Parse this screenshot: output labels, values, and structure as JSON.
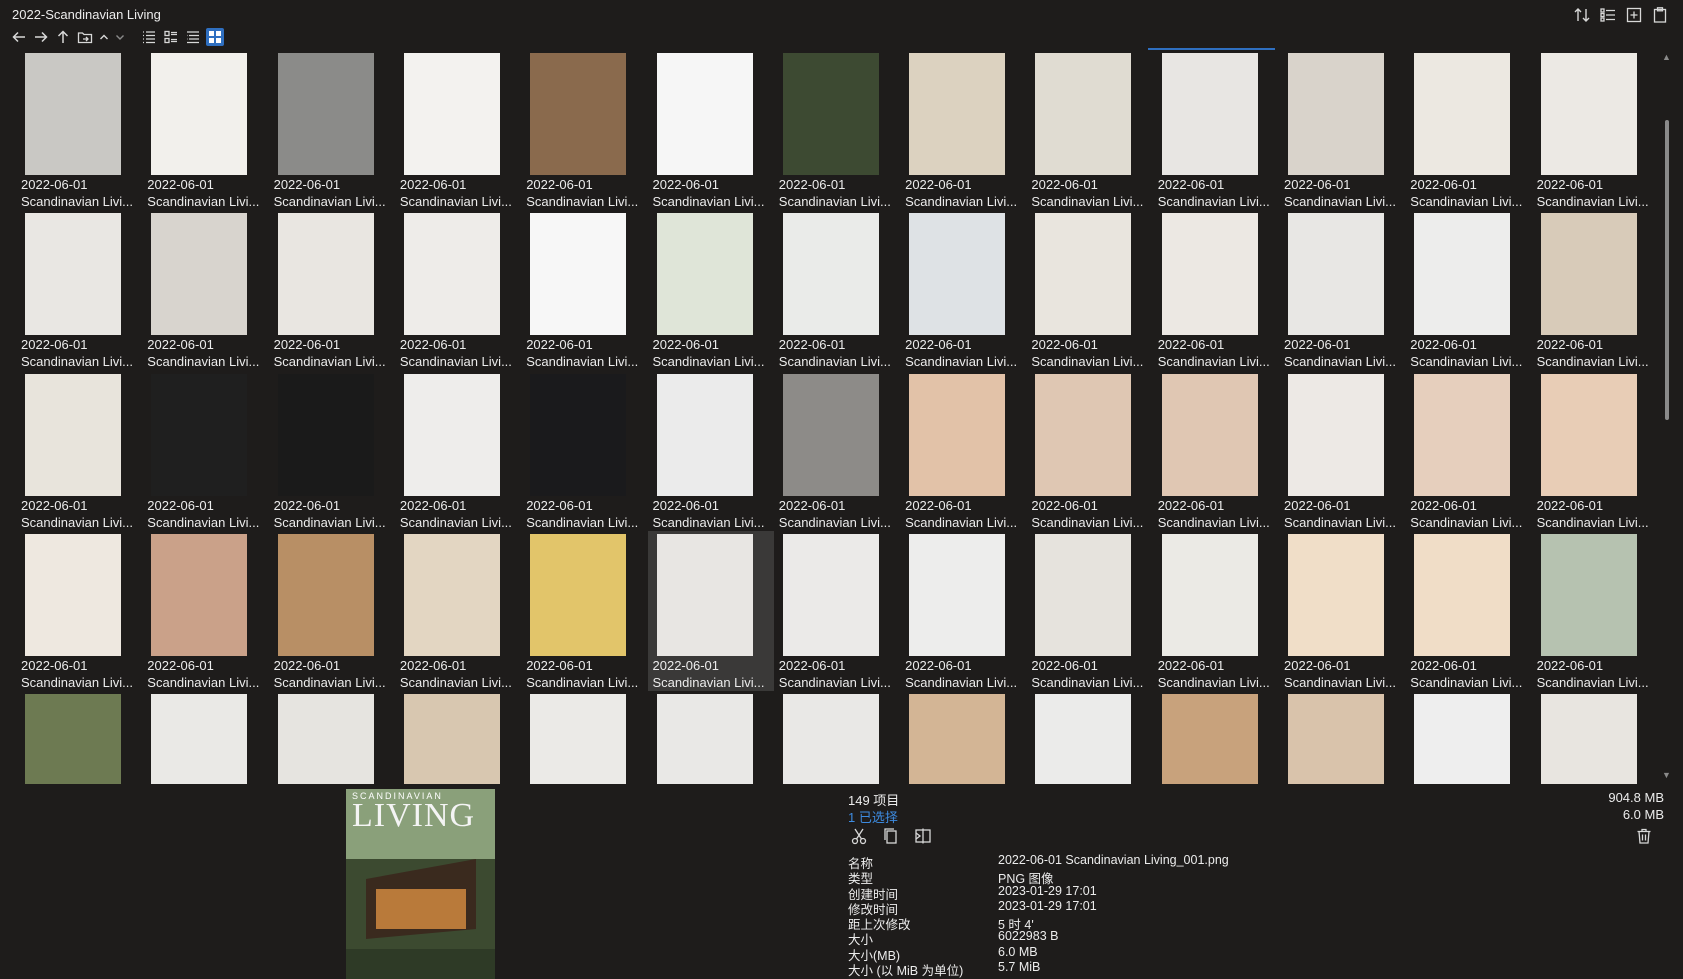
{
  "window": {
    "title": "2022-Scandinavian Living"
  },
  "toolbar": {
    "buttons": [
      "back-icon",
      "forward-icon",
      "up-icon",
      "folder-icon",
      "sort-up-icon",
      "sort-down-icon",
      "list-view-icon",
      "details-view-icon",
      "tree-view-icon",
      "thumbnail-view-icon"
    ],
    "top_right": [
      "sort-icon",
      "panel-icon",
      "new-window-icon",
      "clipboard-icon"
    ]
  },
  "files": [
    {
      "date": "2022-06-01",
      "name": "Scandinavian Livi..."
    },
    {
      "date": "2022-06-01",
      "name": "Scandinavian Livi..."
    },
    {
      "date": "2022-06-01",
      "name": "Scandinavian Livi..."
    },
    {
      "date": "2022-06-01",
      "name": "Scandinavian Livi..."
    },
    {
      "date": "2022-06-01",
      "name": "Scandinavian Livi..."
    },
    {
      "date": "2022-06-01",
      "name": "Scandinavian Livi..."
    },
    {
      "date": "2022-06-01",
      "name": "Scandinavian Livi..."
    },
    {
      "date": "2022-06-01",
      "name": "Scandinavian Livi..."
    },
    {
      "date": "2022-06-01",
      "name": "Scandinavian Livi..."
    },
    {
      "date": "2022-06-01",
      "name": "Scandinavian Livi..."
    },
    {
      "date": "2022-06-01",
      "name": "Scandinavian Livi..."
    },
    {
      "date": "2022-06-01",
      "name": "Scandinavian Livi..."
    },
    {
      "date": "2022-06-01",
      "name": "Scandinavian Livi..."
    },
    {
      "date": "2022-06-01",
      "name": "Scandinavian Livi..."
    },
    {
      "date": "2022-06-01",
      "name": "Scandinavian Livi..."
    },
    {
      "date": "2022-06-01",
      "name": "Scandinavian Livi..."
    },
    {
      "date": "2022-06-01",
      "name": "Scandinavian Livi..."
    },
    {
      "date": "2022-06-01",
      "name": "Scandinavian Livi..."
    },
    {
      "date": "2022-06-01",
      "name": "Scandinavian Livi..."
    },
    {
      "date": "2022-06-01",
      "name": "Scandinavian Livi..."
    },
    {
      "date": "2022-06-01",
      "name": "Scandinavian Livi..."
    },
    {
      "date": "2022-06-01",
      "name": "Scandinavian Livi..."
    },
    {
      "date": "2022-06-01",
      "name": "Scandinavian Livi..."
    },
    {
      "date": "2022-06-01",
      "name": "Scandinavian Livi..."
    },
    {
      "date": "2022-06-01",
      "name": "Scandinavian Livi..."
    },
    {
      "date": "2022-06-01",
      "name": "Scandinavian Livi..."
    },
    {
      "date": "2022-06-01",
      "name": "Scandinavian Livi..."
    },
    {
      "date": "2022-06-01",
      "name": "Scandinavian Livi..."
    },
    {
      "date": "2022-06-01",
      "name": "Scandinavian Livi..."
    },
    {
      "date": "2022-06-01",
      "name": "Scandinavian Livi..."
    },
    {
      "date": "2022-06-01",
      "name": "Scandinavian Livi..."
    },
    {
      "date": "2022-06-01",
      "name": "Scandinavian Livi..."
    },
    {
      "date": "2022-06-01",
      "name": "Scandinavian Livi..."
    },
    {
      "date": "2022-06-01",
      "name": "Scandinavian Livi..."
    },
    {
      "date": "2022-06-01",
      "name": "Scandinavian Livi..."
    },
    {
      "date": "2022-06-01",
      "name": "Scandinavian Livi..."
    },
    {
      "date": "2022-06-01",
      "name": "Scandinavian Livi..."
    },
    {
      "date": "2022-06-01",
      "name": "Scandinavian Livi..."
    },
    {
      "date": "2022-06-01",
      "name": "Scandinavian Livi..."
    },
    {
      "date": "2022-06-01",
      "name": "Scandinavian Livi..."
    },
    {
      "date": "2022-06-01",
      "name": "Scandinavian Livi..."
    },
    {
      "date": "2022-06-01",
      "name": "Scandinavian Livi..."
    },
    {
      "date": "2022-06-01",
      "name": "Scandinavian Livi..."
    },
    {
      "date": "2022-06-01",
      "name": "Scandinavian Livi..."
    },
    {
      "date": "2022-06-01",
      "name": "Scandinavian Livi..."
    },
    {
      "date": "2022-06-01",
      "name": "Scandinavian Livi..."
    },
    {
      "date": "2022-06-01",
      "name": "Scandinavian Livi..."
    },
    {
      "date": "2022-06-01",
      "name": "Scandinavian Livi..."
    },
    {
      "date": "2022-06-01",
      "name": "Scandinavian Livi..."
    },
    {
      "date": "2022-06-01",
      "name": "Scandinavian Livi..."
    },
    {
      "date": "2022-06-01",
      "name": "Scandinavian Livi..."
    },
    {
      "date": "2022-06-01",
      "name": "Scandinavian Livi..."
    },
    {
      "date": "",
      "name": ""
    },
    {
      "date": "",
      "name": ""
    },
    {
      "date": "",
      "name": ""
    },
    {
      "date": "",
      "name": ""
    },
    {
      "date": "",
      "name": ""
    },
    {
      "date": "",
      "name": ""
    },
    {
      "date": "",
      "name": ""
    },
    {
      "date": "",
      "name": ""
    },
    {
      "date": "",
      "name": ""
    },
    {
      "date": "",
      "name": ""
    },
    {
      "date": "",
      "name": ""
    },
    {
      "date": "",
      "name": ""
    },
    {
      "date": "",
      "name": ""
    }
  ],
  "selected_index": 44,
  "thumb_colors": [
    "#c9c8c4",
    "#f2f0ec",
    "#8b8b89",
    "#f3f2ef",
    "#8a6a4d",
    "#f6f6f6",
    "#3d4a32",
    "#dcd2c0",
    "#e0dcd2",
    "#e8e6e3",
    "#d9d3cb",
    "#ece8e1",
    "#ece9e4",
    "#e9e7e3",
    "#d8d4ce",
    "#e9e6e1",
    "#eeece9",
    "#f7f7f7",
    "#dfe5d8",
    "#eaebe9",
    "#dee2e5",
    "#e9e5de",
    "#ece8e3",
    "#e8e7e4",
    "#ededec",
    "#d8cbb9",
    "#e8e4dc",
    "#1f1f1f",
    "#1a1a1a",
    "#eeedeb",
    "#1a1a1c",
    "#ebebeb",
    "#8d8b88",
    "#e2c2a8",
    "#dfc7b3",
    "#e0c7b3",
    "#ede9e5",
    "#e6cfbd",
    "#e8cdb6",
    "#eee8e0",
    "#caa189",
    "#b88f65",
    "#e3d6c2",
    "#e2c56a",
    "#e8e6e3",
    "#ebeae8",
    "#ededec",
    "#e6e3dd",
    "#ebeae5",
    "#f0dec8",
    "#f0ddc7",
    "#b6c2b0",
    "#6d7a52",
    "#eae9e6",
    "#e6e4e0",
    "#d8c7b0",
    "#ebeae7",
    "#e9e8e6",
    "#e9e8e6",
    "#d3b595",
    "#ebebea",
    "#c8a27c",
    "#d9c3ab",
    "#eeeeee",
    "#e8e5e0"
  ],
  "status": {
    "item_count": "149 项目",
    "selected_count": "1 已选择",
    "total_size": "904.8 MB",
    "selected_size": "6.0 MB"
  },
  "actions": [
    "cut-icon",
    "copy-icon",
    "compare-icon"
  ],
  "properties": [
    {
      "label": "名称",
      "value": "2022-06-01 Scandinavian Living_001.png"
    },
    {
      "label": "类型",
      "value": "PNG 图像"
    },
    {
      "label": "创建时间",
      "value": "2023-01-29  17:01"
    },
    {
      "label": "修改时间",
      "value": "2023-01-29  17:01"
    },
    {
      "label": "距上次修改",
      "value": "5 时 4'"
    },
    {
      "label": "大小",
      "value": "6022983 B"
    },
    {
      "label": "大小(MB)",
      "value": "6.0 MB"
    },
    {
      "label": "大小 (以 MiB 为单位)",
      "value": "5.7 MiB"
    }
  ],
  "preview": {
    "brand": "SCANDINAVIAN",
    "title": "LIVING",
    "cover_color": "#6e8a5a"
  },
  "colors": {
    "accent": "#2f6fc0",
    "selection_text": "#3d8be0",
    "background": "#1e1c1b"
  }
}
